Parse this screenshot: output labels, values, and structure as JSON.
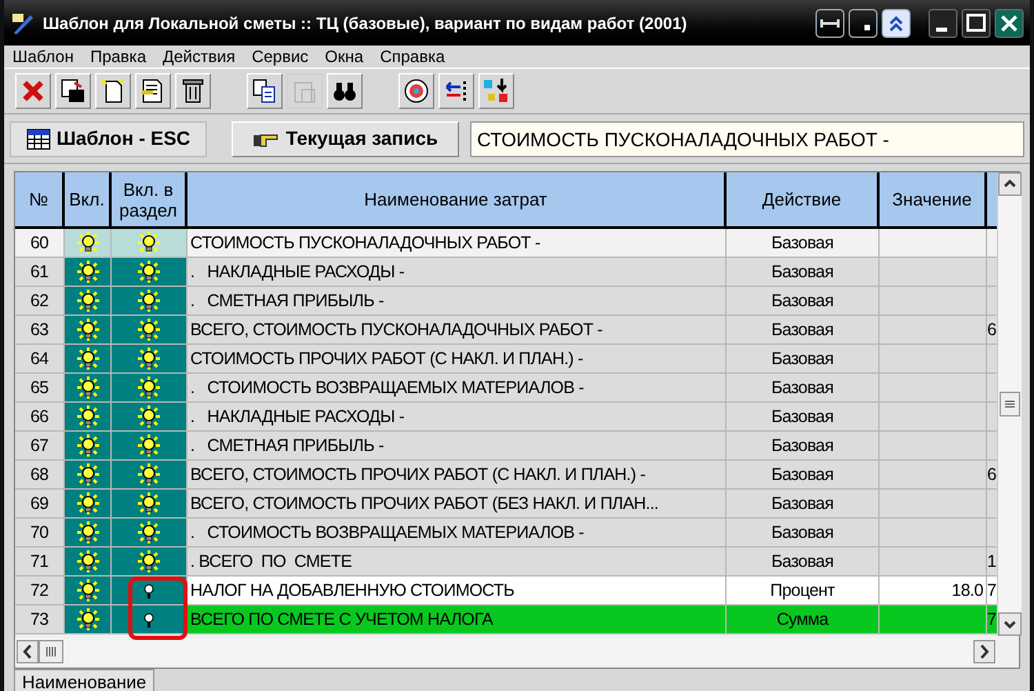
{
  "window": {
    "title": "Шаблон для Локальной сметы :: ТЦ (базовые), вариант по видам работ (2001)"
  },
  "menu": [
    "Шаблон",
    "Правка",
    "Действия",
    "Сервис",
    "Окна",
    "Справка"
  ],
  "toolbar": [
    {
      "kind": "delete",
      "disabled": false
    },
    {
      "kind": "save",
      "disabled": false
    },
    {
      "kind": "new",
      "disabled": false
    },
    {
      "kind": "edit",
      "disabled": false
    },
    {
      "kind": "trash",
      "disabled": false
    },
    {
      "kind": "sep"
    },
    {
      "kind": "copy",
      "disabled": false
    },
    {
      "kind": "paste",
      "disabled": true
    },
    {
      "kind": "find",
      "disabled": false
    },
    {
      "kind": "sep"
    },
    {
      "kind": "target",
      "disabled": false
    },
    {
      "kind": "arrows",
      "disabled": false
    },
    {
      "kind": "sort",
      "disabled": false
    }
  ],
  "template_button": "Шаблон - ESC",
  "current_record_button": "Текущая запись",
  "current_record_field": "СТОИМОСТЬ ПУСКОНАЛАДОЧНЫХ РАБОТ -",
  "table": {
    "columns": [
      "№",
      "Вкл.",
      "Вкл. в раздел",
      "Наименование затрат",
      "Действие",
      "Значение"
    ],
    "rows": [
      {
        "no": "60",
        "enabled": true,
        "in_section": true,
        "name": "СТОИМОСТЬ ПУСКОНАЛАДОЧНЫХ РАБОТ -",
        "action": "Базовая",
        "selected": true,
        "color": "#f2f2f2"
      },
      {
        "no": "61",
        "enabled": true,
        "in_section": true,
        "name": ".   НАКЛАДНЫЕ РАСХОДЫ -",
        "action": "Базовая",
        "selected": false,
        "color": "#dcdcdc"
      },
      {
        "no": "62",
        "enabled": true,
        "in_section": true,
        "name": ".   СМЕТНАЯ ПРИБЫЛЬ -",
        "action": "Базовая",
        "selected": false,
        "color": "#dcdcdc"
      },
      {
        "no": "63",
        "enabled": true,
        "in_section": true,
        "name": "ВСЕГО, СТОИМОСТЬ ПУСКОНАЛАДОЧНЫХ РАБОТ -",
        "action": "Базовая",
        "column_7": "6",
        "selected": false,
        "color": "#dcdcdc"
      },
      {
        "no": "64",
        "enabled": true,
        "in_section": true,
        "name": "СТОИМОСТЬ ПРОЧИХ РАБОТ (С НАКЛ. И ПЛАН.) -",
        "action": "Базовая",
        "selected": false,
        "color": "#dcdcdc"
      },
      {
        "no": "65",
        "enabled": true,
        "in_section": true,
        "name": ".   СТОИМОСТЬ ВОЗВРАЩАЕМЫХ МАТЕРИАЛОВ -",
        "action": "Базовая",
        "selected": false,
        "color": "#dcdcdc"
      },
      {
        "no": "66",
        "enabled": true,
        "in_section": true,
        "name": ".   НАКЛАДНЫЕ РАСХОДЫ -",
        "action": "Базовая",
        "selected": false,
        "color": "#dcdcdc"
      },
      {
        "no": "67",
        "enabled": true,
        "in_section": true,
        "name": ".   СМЕТНАЯ ПРИБЫЛЬ -",
        "action": "Базовая",
        "selected": false,
        "color": "#dcdcdc"
      },
      {
        "no": "68",
        "enabled": true,
        "in_section": true,
        "name": "ВСЕГО, СТОИМОСТЬ ПРОЧИХ РАБОТ (С НАКЛ. И ПЛАН.) -",
        "action": "Базовая",
        "column_7": "6",
        "selected": false,
        "color": "#dcdcdc"
      },
      {
        "no": "69",
        "enabled": true,
        "in_section": true,
        "name": "ВСЕГО, СТОИМОСТЬ ПРОЧИХ РАБОТ (БЕЗ НАКЛ. И ПЛАН...",
        "action": "Базовая",
        "selected": false,
        "color": "#dcdcdc"
      },
      {
        "no": "70",
        "enabled": true,
        "in_section": true,
        "name": ".   СТОИМОСТЬ ВОЗВРАЩАЕМЫХ МАТЕРИАЛОВ -",
        "action": "Базовая",
        "selected": false,
        "color": "#dcdcdc"
      },
      {
        "no": "71",
        "enabled": true,
        "in_section": true,
        "name": ". ВСЕГО  ПО  СМЕТЕ",
        "action": "Базовая",
        "column_7": "1",
        "selected": false,
        "color": "#dcdcdc"
      },
      {
        "no": "72",
        "enabled": true,
        "in_section": false,
        "highlighted": true,
        "name": "НАЛОГ НА ДОБАВЛЕННУЮ СТОИМОСТЬ",
        "action": "Процент",
        "value": "18.0",
        "column_7": "7",
        "selected": false,
        "color": "#ffffff"
      },
      {
        "no": "73",
        "enabled": true,
        "in_section": false,
        "highlighted": true,
        "name": "ВСЕГО ПО СМЕТЕ С УЧЕТОМ НАЛОГА",
        "action": "Сумма",
        "column_7": "7",
        "selected": false,
        "color": "#08c820"
      }
    ]
  },
  "bottom_tab": "Наименование"
}
